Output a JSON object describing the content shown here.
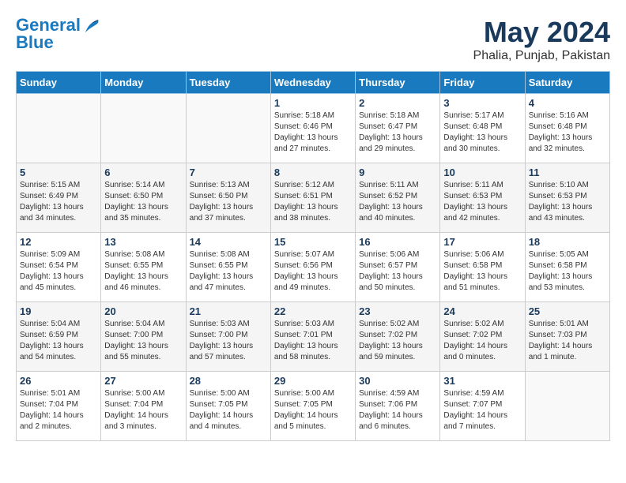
{
  "header": {
    "logo_line1": "General",
    "logo_line2": "Blue",
    "title": "May 2024",
    "subtitle": "Phalia, Punjab, Pakistan"
  },
  "weekdays": [
    "Sunday",
    "Monday",
    "Tuesday",
    "Wednesday",
    "Thursday",
    "Friday",
    "Saturday"
  ],
  "weeks": [
    [
      {
        "day": "",
        "info": ""
      },
      {
        "day": "",
        "info": ""
      },
      {
        "day": "",
        "info": ""
      },
      {
        "day": "1",
        "info": "Sunrise: 5:18 AM\nSunset: 6:46 PM\nDaylight: 13 hours\nand 27 minutes."
      },
      {
        "day": "2",
        "info": "Sunrise: 5:18 AM\nSunset: 6:47 PM\nDaylight: 13 hours\nand 29 minutes."
      },
      {
        "day": "3",
        "info": "Sunrise: 5:17 AM\nSunset: 6:48 PM\nDaylight: 13 hours\nand 30 minutes."
      },
      {
        "day": "4",
        "info": "Sunrise: 5:16 AM\nSunset: 6:48 PM\nDaylight: 13 hours\nand 32 minutes."
      }
    ],
    [
      {
        "day": "5",
        "info": "Sunrise: 5:15 AM\nSunset: 6:49 PM\nDaylight: 13 hours\nand 34 minutes."
      },
      {
        "day": "6",
        "info": "Sunrise: 5:14 AM\nSunset: 6:50 PM\nDaylight: 13 hours\nand 35 minutes."
      },
      {
        "day": "7",
        "info": "Sunrise: 5:13 AM\nSunset: 6:50 PM\nDaylight: 13 hours\nand 37 minutes."
      },
      {
        "day": "8",
        "info": "Sunrise: 5:12 AM\nSunset: 6:51 PM\nDaylight: 13 hours\nand 38 minutes."
      },
      {
        "day": "9",
        "info": "Sunrise: 5:11 AM\nSunset: 6:52 PM\nDaylight: 13 hours\nand 40 minutes."
      },
      {
        "day": "10",
        "info": "Sunrise: 5:11 AM\nSunset: 6:53 PM\nDaylight: 13 hours\nand 42 minutes."
      },
      {
        "day": "11",
        "info": "Sunrise: 5:10 AM\nSunset: 6:53 PM\nDaylight: 13 hours\nand 43 minutes."
      }
    ],
    [
      {
        "day": "12",
        "info": "Sunrise: 5:09 AM\nSunset: 6:54 PM\nDaylight: 13 hours\nand 45 minutes."
      },
      {
        "day": "13",
        "info": "Sunrise: 5:08 AM\nSunset: 6:55 PM\nDaylight: 13 hours\nand 46 minutes."
      },
      {
        "day": "14",
        "info": "Sunrise: 5:08 AM\nSunset: 6:55 PM\nDaylight: 13 hours\nand 47 minutes."
      },
      {
        "day": "15",
        "info": "Sunrise: 5:07 AM\nSunset: 6:56 PM\nDaylight: 13 hours\nand 49 minutes."
      },
      {
        "day": "16",
        "info": "Sunrise: 5:06 AM\nSunset: 6:57 PM\nDaylight: 13 hours\nand 50 minutes."
      },
      {
        "day": "17",
        "info": "Sunrise: 5:06 AM\nSunset: 6:58 PM\nDaylight: 13 hours\nand 51 minutes."
      },
      {
        "day": "18",
        "info": "Sunrise: 5:05 AM\nSunset: 6:58 PM\nDaylight: 13 hours\nand 53 minutes."
      }
    ],
    [
      {
        "day": "19",
        "info": "Sunrise: 5:04 AM\nSunset: 6:59 PM\nDaylight: 13 hours\nand 54 minutes."
      },
      {
        "day": "20",
        "info": "Sunrise: 5:04 AM\nSunset: 7:00 PM\nDaylight: 13 hours\nand 55 minutes."
      },
      {
        "day": "21",
        "info": "Sunrise: 5:03 AM\nSunset: 7:00 PM\nDaylight: 13 hours\nand 57 minutes."
      },
      {
        "day": "22",
        "info": "Sunrise: 5:03 AM\nSunset: 7:01 PM\nDaylight: 13 hours\nand 58 minutes."
      },
      {
        "day": "23",
        "info": "Sunrise: 5:02 AM\nSunset: 7:02 PM\nDaylight: 13 hours\nand 59 minutes."
      },
      {
        "day": "24",
        "info": "Sunrise: 5:02 AM\nSunset: 7:02 PM\nDaylight: 14 hours\nand 0 minutes."
      },
      {
        "day": "25",
        "info": "Sunrise: 5:01 AM\nSunset: 7:03 PM\nDaylight: 14 hours\nand 1 minute."
      }
    ],
    [
      {
        "day": "26",
        "info": "Sunrise: 5:01 AM\nSunset: 7:04 PM\nDaylight: 14 hours\nand 2 minutes."
      },
      {
        "day": "27",
        "info": "Sunrise: 5:00 AM\nSunset: 7:04 PM\nDaylight: 14 hours\nand 3 minutes."
      },
      {
        "day": "28",
        "info": "Sunrise: 5:00 AM\nSunset: 7:05 PM\nDaylight: 14 hours\nand 4 minutes."
      },
      {
        "day": "29",
        "info": "Sunrise: 5:00 AM\nSunset: 7:05 PM\nDaylight: 14 hours\nand 5 minutes."
      },
      {
        "day": "30",
        "info": "Sunrise: 4:59 AM\nSunset: 7:06 PM\nDaylight: 14 hours\nand 6 minutes."
      },
      {
        "day": "31",
        "info": "Sunrise: 4:59 AM\nSunset: 7:07 PM\nDaylight: 14 hours\nand 7 minutes."
      },
      {
        "day": "",
        "info": ""
      }
    ]
  ]
}
